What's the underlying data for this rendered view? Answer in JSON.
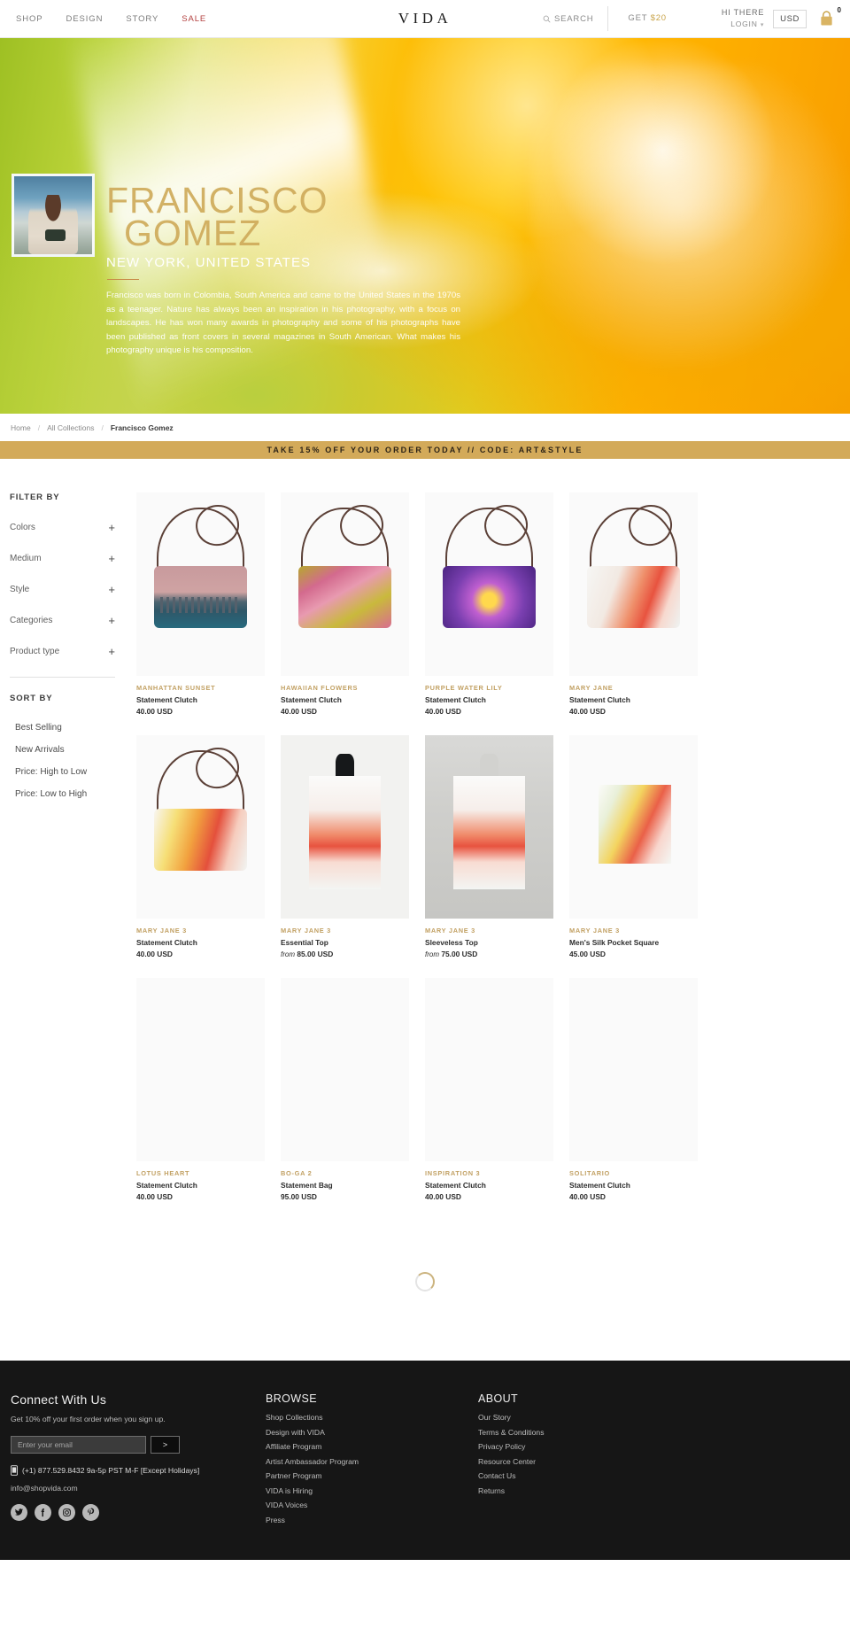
{
  "header": {
    "nav": [
      {
        "label": "SHOP",
        "name": "nav-shop",
        "sale": false
      },
      {
        "label": "DESIGN",
        "name": "nav-design",
        "sale": false
      },
      {
        "label": "STORY",
        "name": "nav-story",
        "sale": false
      },
      {
        "label": "SALE",
        "name": "nav-sale",
        "sale": true
      }
    ],
    "brand": "VIDA",
    "search_label": "SEARCH",
    "get_label": "GET",
    "get_amount": "$20",
    "greeting": "HI THERE",
    "login_label": "LOGIN",
    "currency": "USD",
    "cart_count": "0",
    "accent_gold": "#c9a44a",
    "sale_red": "#b3403f"
  },
  "hero": {
    "artist_name_line1": "FRANCISCO",
    "artist_name_line2": "GOMEZ",
    "location": "NEW YORK, UNITED STATES",
    "bio": "Francisco was born in Colombia, South America and came to the United States in the 1970s as a teenager. Nature has always been an inspiration in his photography, with a focus on landscapes. He has won many awards in photography and some of his photographs have been published as front covers in several magazines in South American. What makes his photography unique is his composition.",
    "name_color": "#ceaa5a"
  },
  "breadcrumb": {
    "home": "Home",
    "collections": "All Collections",
    "current": "Francisco Gomez",
    "separator": "/"
  },
  "promo": {
    "text": "TAKE 15% OFF YOUR ORDER TODAY // CODE: ART&STYLE",
    "bg": "#d3aa5a"
  },
  "sidebar": {
    "filter_title": "FILTER BY",
    "filters": [
      {
        "label": "Colors",
        "icon": "+"
      },
      {
        "label": "Medium",
        "icon": "+"
      },
      {
        "label": "Style",
        "icon": "+"
      },
      {
        "label": "Categories",
        "icon": "+"
      },
      {
        "label": "Product type",
        "icon": "+"
      }
    ],
    "sort_title": "SORT BY",
    "sort_options": [
      "Best Selling",
      "New Arrivals",
      "Price: High to Low",
      "Price: Low to High"
    ]
  },
  "products": [
    {
      "title": "MANHATTAN SUNSET",
      "type": "Statement Clutch",
      "price": "40.00 USD",
      "from": "",
      "art": "manhattan"
    },
    {
      "title": "HAWAIIAN FLOWERS",
      "type": "Statement Clutch",
      "price": "40.00 USD",
      "from": "",
      "art": "hawaiian"
    },
    {
      "title": "PURPLE WATER LILY",
      "type": "Statement Clutch",
      "price": "40.00 USD",
      "from": "",
      "art": "lily"
    },
    {
      "title": "MARY JANE",
      "type": "Statement Clutch",
      "price": "40.00 USD",
      "from": "",
      "art": "mj"
    },
    {
      "title": "MARY JANE 3",
      "type": "Statement Clutch",
      "price": "40.00 USD",
      "from": "",
      "art": "mj3"
    },
    {
      "title": "MARY JANE 3",
      "type": "Essential Top",
      "price": "85.00 USD",
      "from": "from",
      "art": "top-dark"
    },
    {
      "title": "MARY JANE 3",
      "type": "Sleeveless Top",
      "price": "75.00 USD",
      "from": "from",
      "art": "top-light"
    },
    {
      "title": "MARY JANE 3",
      "type": "Men's Silk Pocket Square",
      "price": "45.00 USD",
      "from": "",
      "art": "square"
    },
    {
      "title": "LOTUS HEART",
      "type": "Statement Clutch",
      "price": "40.00 USD",
      "from": "",
      "art": "empty"
    },
    {
      "title": "BO-GA 2",
      "type": "Statement Bag",
      "price": "95.00 USD",
      "from": "",
      "art": "empty"
    },
    {
      "title": "INSPIRATION 3",
      "type": "Statement Clutch",
      "price": "40.00 USD",
      "from": "",
      "art": "empty"
    },
    {
      "title": "SOLITARIO",
      "type": "Statement Clutch",
      "price": "40.00 USD",
      "from": "",
      "art": "empty"
    }
  ],
  "footer": {
    "connect": {
      "title": "Connect With Us",
      "subtitle": "Get 10% off your first order when you sign up.",
      "email_placeholder": "Enter your email",
      "email_value": "",
      "submit_label": ">",
      "phone": "(+1) 877.529.8432 9a-5p PST M-F [Except Holidays]",
      "email": "info@shopvida.com",
      "socials": [
        {
          "name": "twitter-icon",
          "glyph": "t"
        },
        {
          "name": "facebook-icon",
          "glyph": "f"
        },
        {
          "name": "instagram-icon",
          "glyph": "i"
        },
        {
          "name": "pinterest-icon",
          "glyph": "p"
        }
      ]
    },
    "browse": {
      "title": "BROWSE",
      "links": [
        "Shop Collections",
        "Design with VIDA",
        "Affiliate Program",
        "Artist Ambassador Program",
        "Partner Program",
        "VIDA is Hiring",
        "VIDA Voices",
        "Press"
      ]
    },
    "about": {
      "title": "ABOUT",
      "links": [
        "Our Story",
        "Terms & Conditions",
        "Privacy Policy",
        "Resource Center",
        "Contact Us",
        "Returns"
      ]
    }
  }
}
